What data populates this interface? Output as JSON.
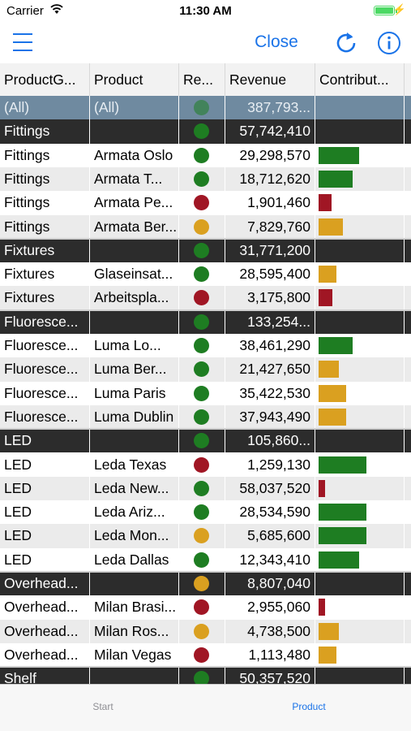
{
  "status": {
    "carrier": "Carrier",
    "time": "11:30 AM"
  },
  "nav": {
    "close_label": "Close"
  },
  "colors": {
    "green": "#1e7d22",
    "red": "#a01624",
    "amber": "#daa020",
    "accent": "#1a73e8"
  },
  "table": {
    "headers": [
      "ProductG...",
      "Product",
      "Re...",
      "Revenue",
      "Contribut..."
    ],
    "rows": [
      {
        "type": "all",
        "group": "(All)",
        "product": "(All)",
        "status": "green",
        "revenue": "387,793...",
        "bar": null
      },
      {
        "type": "group",
        "group": "Fittings",
        "product": "",
        "status": "green",
        "revenue": "57,742,410",
        "bar": null
      },
      {
        "type": "leaf",
        "group": "Fittings",
        "product": "Armata Oslo",
        "status": "green",
        "revenue": "29,298,570",
        "bar": {
          "color": "green",
          "value": 0.56
        }
      },
      {
        "type": "leaf",
        "group": "Fittings",
        "product": "Armata T...",
        "status": "green",
        "revenue": "18,712,620",
        "bar": {
          "color": "green",
          "value": 0.47
        }
      },
      {
        "type": "leaf",
        "group": "Fittings",
        "product": "Armata Pe...",
        "status": "red",
        "revenue": "1,901,460",
        "bar": {
          "color": "red",
          "value": 0.18
        }
      },
      {
        "type": "leaf",
        "group": "Fittings",
        "product": "Armata Ber...",
        "status": "amber",
        "revenue": "7,829,760",
        "bar": {
          "color": "amber",
          "value": 0.33
        }
      },
      {
        "type": "group",
        "group": "Fixtures",
        "product": "",
        "status": "green",
        "revenue": "31,771,200",
        "bar": null
      },
      {
        "type": "leaf",
        "group": "Fixtures",
        "product": "Glaseinsat...",
        "status": "green",
        "revenue": "28,595,400",
        "bar": {
          "color": "amber",
          "value": 0.24
        }
      },
      {
        "type": "leaf",
        "group": "Fixtures",
        "product": "Arbeitspla...",
        "status": "red",
        "revenue": "3,175,800",
        "bar": {
          "color": "red",
          "value": 0.19
        }
      },
      {
        "type": "group",
        "group": "Fluoresce...",
        "product": "",
        "status": "green",
        "revenue": "133,254...",
        "bar": null
      },
      {
        "type": "leaf",
        "group": "Fluoresce...",
        "product": "Luma Lo...",
        "status": "green",
        "revenue": "38,461,290",
        "bar": {
          "color": "green",
          "value": 0.47
        }
      },
      {
        "type": "leaf",
        "group": "Fluoresce...",
        "product": "Luma Ber...",
        "status": "green",
        "revenue": "21,427,650",
        "bar": {
          "color": "amber",
          "value": 0.28
        }
      },
      {
        "type": "leaf",
        "group": "Fluoresce...",
        "product": "Luma Paris",
        "status": "green",
        "revenue": "35,422,530",
        "bar": {
          "color": "amber",
          "value": 0.38
        }
      },
      {
        "type": "leaf",
        "group": "Fluoresce...",
        "product": "Luma Dublin",
        "status": "green",
        "revenue": "37,943,490",
        "bar": {
          "color": "amber",
          "value": 0.38
        }
      },
      {
        "type": "group",
        "group": "LED",
        "product": "",
        "status": "green",
        "revenue": "105,860...",
        "bar": null
      },
      {
        "type": "leaf",
        "group": "LED",
        "product": "Leda Texas",
        "status": "red",
        "revenue": "1,259,130",
        "bar": {
          "color": "green",
          "value": 0.66
        }
      },
      {
        "type": "leaf",
        "group": "LED",
        "product": "Leda New...",
        "status": "green",
        "revenue": "58,037,520",
        "bar": {
          "color": "red",
          "value": 0.09
        }
      },
      {
        "type": "leaf",
        "group": "LED",
        "product": "Leda Ariz...",
        "status": "green",
        "revenue": "28,534,590",
        "bar": {
          "color": "green",
          "value": 0.66
        }
      },
      {
        "type": "leaf",
        "group": "LED",
        "product": "Leda Mon...",
        "status": "amber",
        "revenue": "5,685,600",
        "bar": {
          "color": "green",
          "value": 0.66
        }
      },
      {
        "type": "leaf",
        "group": "LED",
        "product": "Leda Dallas",
        "status": "green",
        "revenue": "12,343,410",
        "bar": {
          "color": "green",
          "value": 0.56
        }
      },
      {
        "type": "group",
        "group": "Overhead...",
        "product": "",
        "status": "amber",
        "revenue": "8,807,040",
        "bar": null
      },
      {
        "type": "leaf",
        "group": "Overhead...",
        "product": "Milan Brasi...",
        "status": "red",
        "revenue": "2,955,060",
        "bar": {
          "color": "red",
          "value": 0.09
        }
      },
      {
        "type": "leaf",
        "group": "Overhead...",
        "product": "Milan Ros...",
        "status": "amber",
        "revenue": "4,738,500",
        "bar": {
          "color": "amber",
          "value": 0.28
        }
      },
      {
        "type": "leaf",
        "group": "Overhead...",
        "product": "Milan Vegas",
        "status": "red",
        "revenue": "1,113,480",
        "bar": {
          "color": "amber",
          "value": 0.24
        }
      },
      {
        "type": "group",
        "group": "Shelf",
        "product": "",
        "status": "green",
        "revenue": "50,357,520",
        "bar": null
      }
    ]
  },
  "tabs": {
    "start_label": "Start",
    "product_label": "Product"
  }
}
